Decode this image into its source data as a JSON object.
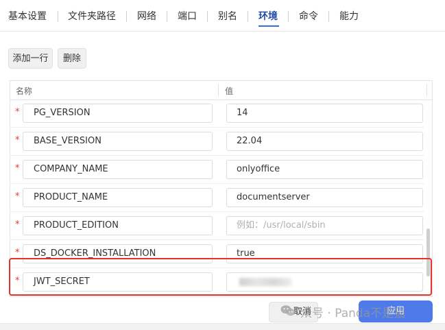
{
  "tabs": [
    {
      "label": "基本设置"
    },
    {
      "label": "文件夹路径"
    },
    {
      "label": "网络"
    },
    {
      "label": "端口"
    },
    {
      "label": "别名"
    },
    {
      "label": "环境",
      "active": true
    },
    {
      "label": "命令"
    },
    {
      "label": "能力"
    }
  ],
  "toolbar": {
    "add_row": "添加一行",
    "delete": "删除"
  },
  "table": {
    "headers": {
      "name": "名称",
      "value": "值"
    },
    "required_mark": "*",
    "rows": [
      {
        "name": "PG_VERSION",
        "value": "14"
      },
      {
        "name": "BASE_VERSION",
        "value": "22.04"
      },
      {
        "name": "COMPANY_NAME",
        "value": "onlyoffice"
      },
      {
        "name": "PRODUCT_NAME",
        "value": "documentserver"
      },
      {
        "name": "PRODUCT_EDITION",
        "value": "",
        "placeholder": "例如：/usr/local/sbin"
      },
      {
        "name": "DS_DOCKER_INSTALLATION",
        "value": "true"
      },
      {
        "name": "JWT_SECRET",
        "value": "",
        "blurred": true
      }
    ]
  },
  "footer": {
    "cancel": "取消",
    "apply": "应用"
  },
  "watermark": {
    "text": "众号 · Panda不是猫"
  },
  "colors": {
    "accent": "#4f7bea",
    "highlight": "#e5312c",
    "required": "#e03a3a",
    "active_tab": "#1f4aa8"
  }
}
